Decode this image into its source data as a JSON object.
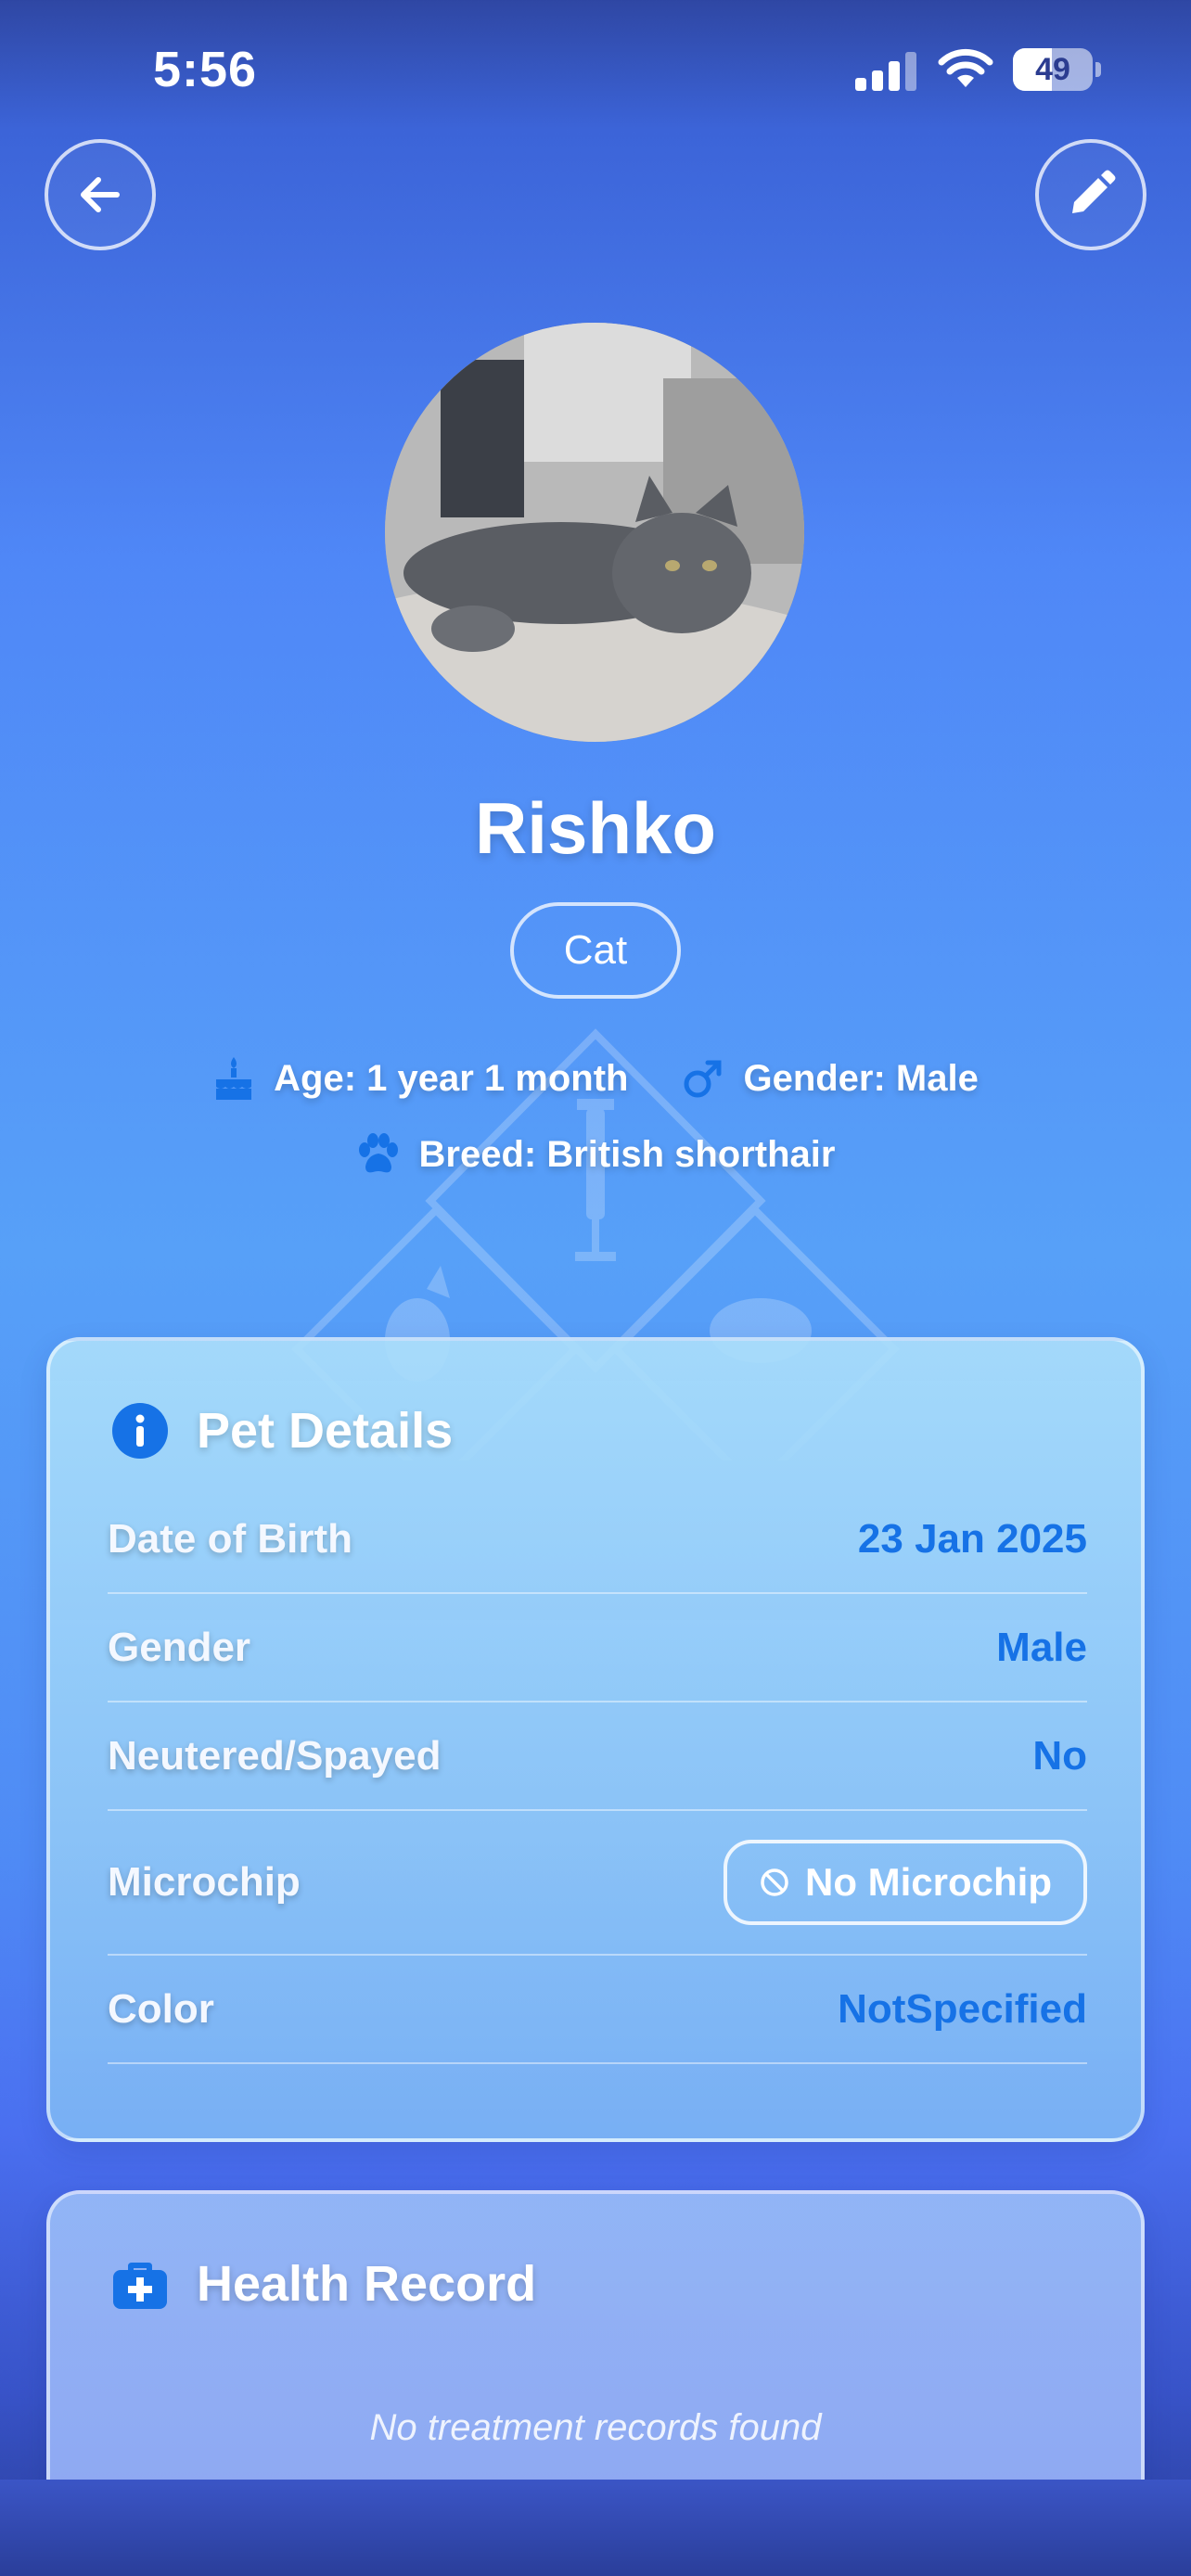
{
  "status_bar": {
    "time": "5:56",
    "battery_level": "49",
    "battery_fraction": 0.49
  },
  "header": {
    "back_icon": "arrow-left-icon",
    "edit_icon": "pencil-icon"
  },
  "pet": {
    "name": "Rishko",
    "species": "Cat",
    "age_text": "Age: 1 year 1 month",
    "gender_text": "Gender: Male",
    "breed_text": "Breed: British shorthair"
  },
  "details": {
    "title": "Pet Details",
    "rows": [
      {
        "label": "Date of Birth",
        "value": "23 Jan 2025"
      },
      {
        "label": "Gender",
        "value": "Male"
      },
      {
        "label": "Neutered/Spayed",
        "value": "No"
      },
      {
        "label": "Microchip",
        "value": "No Microchip"
      },
      {
        "label": "Color",
        "value": "NotSpecified"
      }
    ]
  },
  "health": {
    "title": "Health Record",
    "empty_text": "No treatment records found"
  },
  "colors": {
    "accent": "#1672e6",
    "background_top": "#2f47a4",
    "background_mid": "#57a0f8"
  }
}
